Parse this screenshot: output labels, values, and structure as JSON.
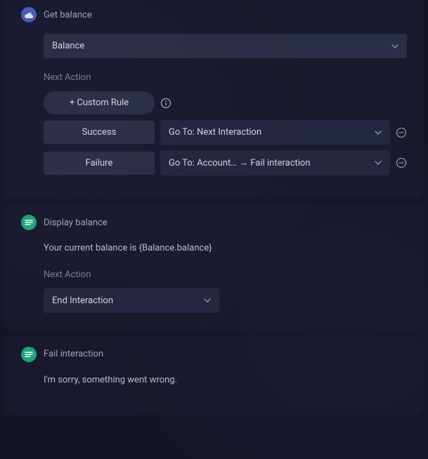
{
  "cards": [
    {
      "title": "Get balance",
      "icon": "cloud",
      "primarySelect": "Balance",
      "nextActionLabel": "Next Action",
      "customRuleLabel": "+ Custom Rule",
      "rules": [
        {
          "label": "Success",
          "target": "Go To: Next Interaction"
        },
        {
          "label": "Failure",
          "target": "Go To: Account… → Fail interaction"
        }
      ]
    },
    {
      "title": "Display balance",
      "icon": "lines",
      "message": "Your current balance is {Balance.balance}",
      "nextActionLabel": "Next Action",
      "nextActionSelect": "End Interaction"
    },
    {
      "title": "Fail interaction",
      "icon": "lines",
      "message": "I'm sorry, something went wrong."
    }
  ]
}
